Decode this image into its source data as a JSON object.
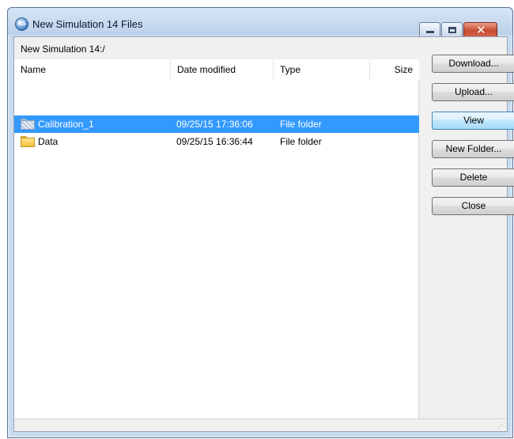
{
  "window": {
    "title": "New Simulation 14 Files",
    "app_icon_text": "RS",
    "close_glyph": "✕"
  },
  "path": "New Simulation 14:/",
  "columns": {
    "name": "Name",
    "date_modified": "Date modified",
    "type": "Type",
    "size": "Size"
  },
  "rows": [
    {
      "name": "Calibration_1",
      "date_modified": "09/25/15 17:36:06",
      "type": "File folder",
      "size": "",
      "selected": true
    },
    {
      "name": "Data",
      "date_modified": "09/25/15 16:36:44",
      "type": "File folder",
      "size": "",
      "selected": false
    }
  ],
  "buttons": {
    "download": "Download...",
    "upload": "Upload...",
    "view": "View",
    "new_folder": "New Folder...",
    "delete": "Delete",
    "close": "Close"
  },
  "colors": {
    "selection": "#3399ff",
    "default_button": "#bee6fd"
  },
  "icons": {
    "app": "rs-app-icon",
    "folder": "folder-icon",
    "minimize": "minimize-icon",
    "maximize": "maximize-icon",
    "close": "close-icon",
    "grip": "resize-grip-icon"
  }
}
